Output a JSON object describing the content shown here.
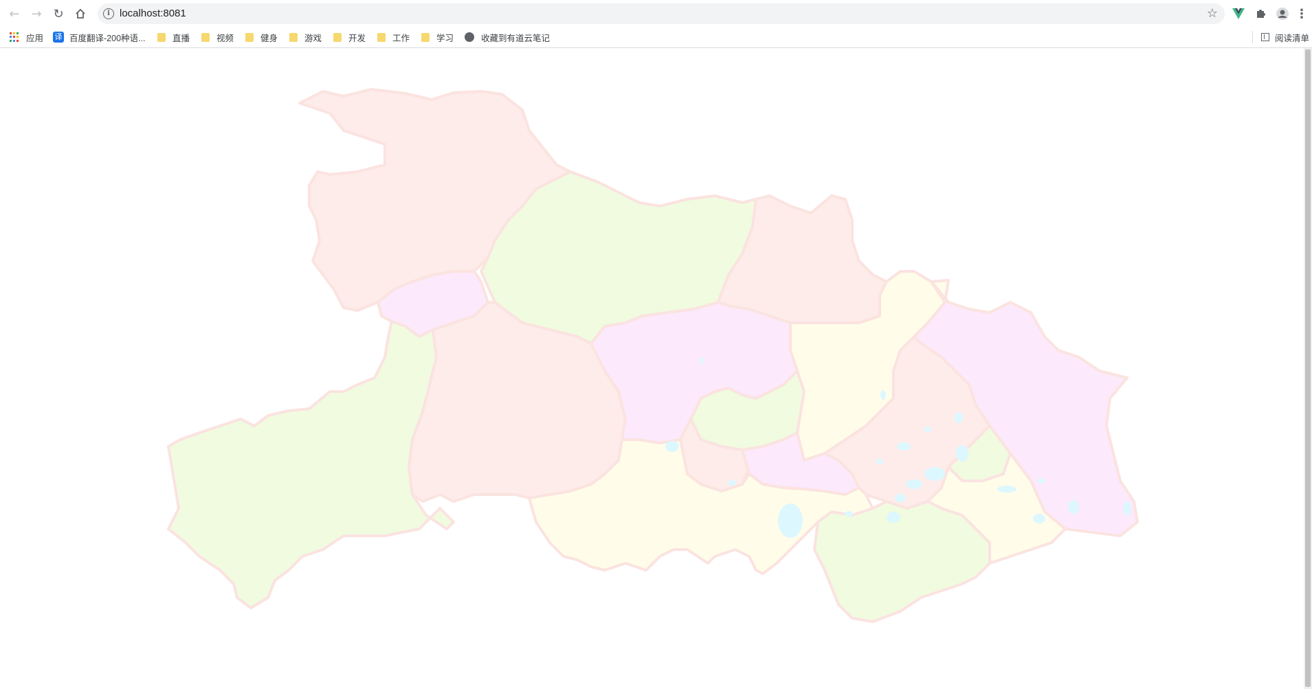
{
  "browser": {
    "url": "localhost:8081",
    "bookmarks": [
      {
        "label": "应用",
        "icon": "apps-icon"
      },
      {
        "label": "百度翻译-200种语...",
        "icon": "translate-icon"
      },
      {
        "label": "直播",
        "icon": "folder-icon"
      },
      {
        "label": "视频",
        "icon": "folder-icon"
      },
      {
        "label": "健身",
        "icon": "folder-icon"
      },
      {
        "label": "游戏",
        "icon": "folder-icon"
      },
      {
        "label": "开发",
        "icon": "folder-icon"
      },
      {
        "label": "工作",
        "icon": "folder-icon"
      },
      {
        "label": "学习",
        "icon": "folder-icon"
      },
      {
        "label": "收藏到有道云笔记",
        "icon": "globe-icon"
      }
    ],
    "translate_glyph": "译",
    "reading_list": "阅读清单"
  },
  "map": {
    "region_colors": {
      "pink": "#fdecea",
      "green": "#f0fbe0",
      "magenta": "#fce9fb",
      "yellow": "#fffde9",
      "water": "#ddf7ff",
      "border": "#fbe3e0"
    }
  }
}
